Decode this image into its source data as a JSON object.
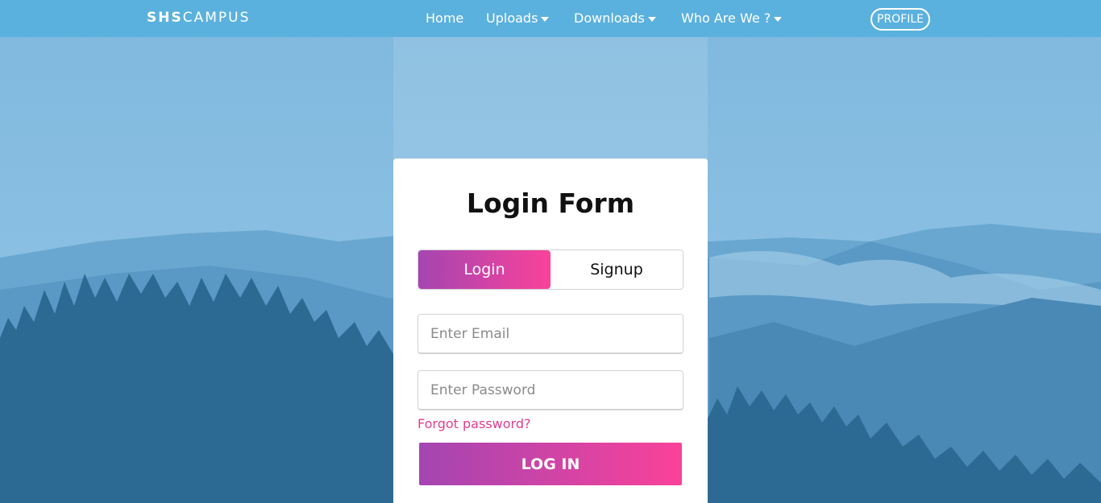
{
  "navbar": {
    "brand_bold": "SHS",
    "brand_light": "CAMPUS",
    "home": "Home",
    "uploads": "Uploads",
    "downloads": "Downloads",
    "who": "Who Are We ?",
    "profile": "PROFILE"
  },
  "form": {
    "title": "Login Form",
    "tab_login": "Login",
    "tab_signup": "Signup",
    "email_placeholder": "Enter Email",
    "password_placeholder": "Enter Password",
    "forgot": "Forgot password?",
    "submit": "LOG IN"
  },
  "colors": {
    "navbar": "#5bb1de",
    "gradient_start": "#a445b2",
    "gradient_end": "#fa4299",
    "link": "#e13d8e",
    "sky": "#8cc1e3",
    "forest": "#2d6a93"
  }
}
